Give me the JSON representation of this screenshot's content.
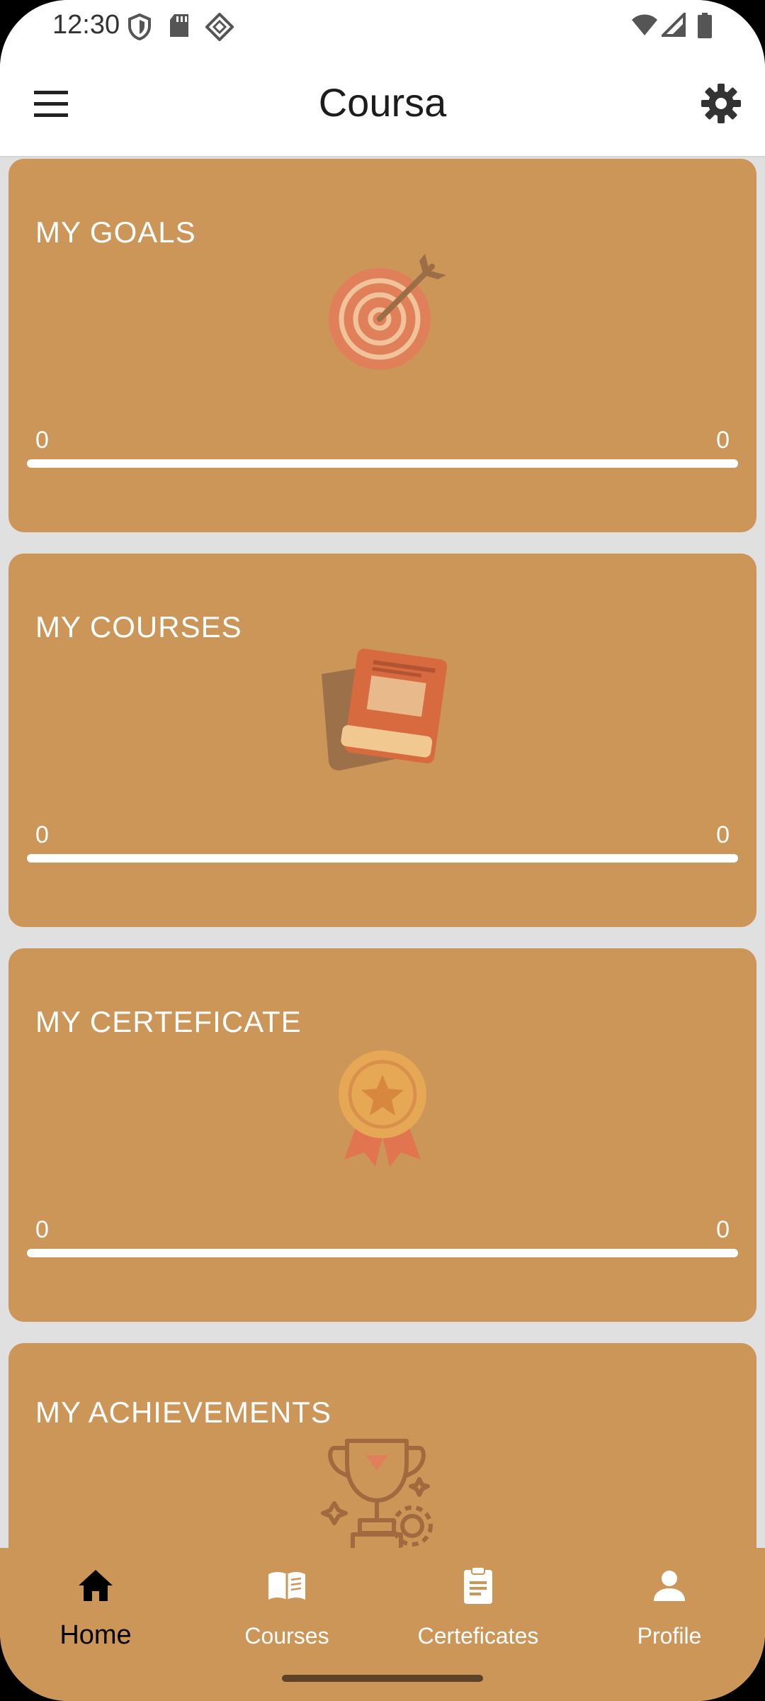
{
  "status_bar": {
    "time": "12:30",
    "left_icons": [
      "shield-icon",
      "sd-card-icon",
      "vpn-diamond-icon"
    ],
    "right_icons": [
      "wifi-icon",
      "signal-icon",
      "battery-icon"
    ]
  },
  "app_bar": {
    "title": "Coursa",
    "menu_icon": "hamburger-menu-icon",
    "settings_icon": "gear-icon"
  },
  "colors": {
    "card": "#cc9659",
    "bottom_nav": "#cc9659",
    "background": "#e0e0e0"
  },
  "cards": [
    {
      "title": "MY GOALS",
      "icon": "target-icon",
      "min": "0",
      "max": "0"
    },
    {
      "title": "MY COURSES",
      "icon": "books-icon",
      "min": "0",
      "max": "0"
    },
    {
      "title": "MY CERTEFICATE",
      "icon": "medal-icon",
      "min": "0",
      "max": "0"
    },
    {
      "title": "MY ACHIEVEMENTS",
      "icon": "trophy-icon"
    }
  ],
  "bottom_nav": {
    "items": [
      {
        "label": "Home",
        "icon": "home-icon",
        "active": true
      },
      {
        "label": "Courses",
        "icon": "book-open-icon",
        "active": false
      },
      {
        "label": "Certeficates",
        "icon": "clipboard-icon",
        "active": false
      },
      {
        "label": "Profile",
        "icon": "person-icon",
        "active": false
      }
    ]
  }
}
